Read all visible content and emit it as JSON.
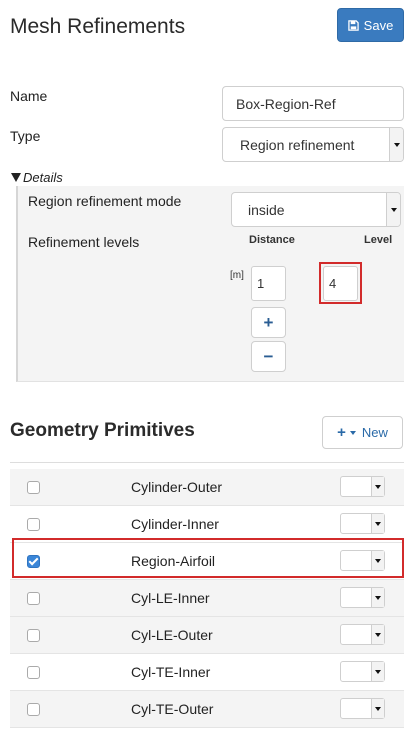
{
  "header": {
    "title": "Mesh Refinements",
    "save_label": "Save",
    "save_icon": "floppy-disk-icon"
  },
  "form": {
    "name_label": "Name",
    "name_value": "Box-Region-Ref",
    "type_label": "Type",
    "type_value": "Region refinement"
  },
  "details": {
    "toggle_label": "Details",
    "mode_label": "Region refinement mode",
    "mode_value": "inside",
    "levels_label": "Refinement levels",
    "distance_header": "Distance",
    "level_header": "Level",
    "unit": "[m]",
    "distance_value": "1",
    "level_value": "4",
    "add_label": "+",
    "remove_label": "−"
  },
  "geometry": {
    "title": "Geometry Primitives",
    "new_label": "New",
    "rows": [
      {
        "name": "Cylinder-Outer",
        "checked": false
      },
      {
        "name": "Cylinder-Inner",
        "checked": false
      },
      {
        "name": "Region-Airfoil",
        "checked": true
      },
      {
        "name": "Cyl-LE-Inner",
        "checked": false
      },
      {
        "name": "Cyl-LE-Outer",
        "checked": false
      },
      {
        "name": "Cyl-TE-Inner",
        "checked": false
      },
      {
        "name": "Cyl-TE-Outer",
        "checked": false
      }
    ]
  },
  "colors": {
    "primary": "#3a7bbf",
    "highlight": "#d22b2b",
    "checkbox": "#3a86d8"
  }
}
